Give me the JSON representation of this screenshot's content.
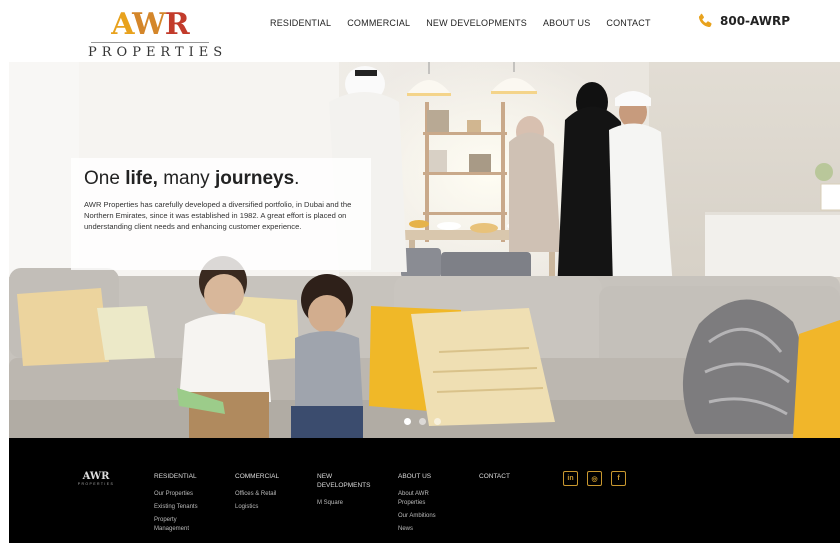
{
  "brand": {
    "mark_a": "A",
    "mark_w": "W",
    "mark_r": "R",
    "sub": "PROPERTIES",
    "colors": {
      "gold": "#e8a21d",
      "orange": "#d4862a",
      "red": "#c23b2b",
      "icon_gold": "#c9982f"
    }
  },
  "nav": {
    "items": [
      "RESIDENTIAL",
      "COMMERCIAL",
      "NEW DEVELOPMENTS",
      "ABOUT US",
      "CONTACT"
    ]
  },
  "phone": {
    "number": "800-AWRP",
    "icon": "phone-icon"
  },
  "hero": {
    "title_part1": "One ",
    "title_bold1": "life,",
    "title_part2": " many ",
    "title_bold2": "journeys",
    "title_end": ".",
    "body": "AWR Properties has carefully developed a diversified portfolio, in Dubai and the Northern Emirates, since it was established in 1982. A great effort is placed on understanding client needs and enhancing customer experience.",
    "slides": 3,
    "active_slide": 1
  },
  "footer": {
    "logo_mark": "AWR",
    "logo_sub": "PROPERTIES",
    "columns": [
      {
        "head": "RESIDENTIAL",
        "links": [
          "Our Properties",
          "Existing Tenants",
          "Property",
          "Management"
        ]
      },
      {
        "head": "COMMERCIAL",
        "links": [
          "Offices & Retail",
          "Logistics"
        ]
      },
      {
        "head": "NEW",
        "head2": "DEVELOPMENTS",
        "links": [
          "M Square"
        ]
      },
      {
        "head": "ABOUT US",
        "links": [
          "About AWR",
          "Properties",
          "Our Ambitions",
          "News"
        ]
      },
      {
        "head": "CONTACT",
        "links": []
      }
    ],
    "social": [
      {
        "icon": "linkedin-icon",
        "glyph": "in"
      },
      {
        "icon": "instagram-icon",
        "glyph": "◎"
      },
      {
        "icon": "facebook-icon",
        "glyph": "f"
      }
    ]
  }
}
